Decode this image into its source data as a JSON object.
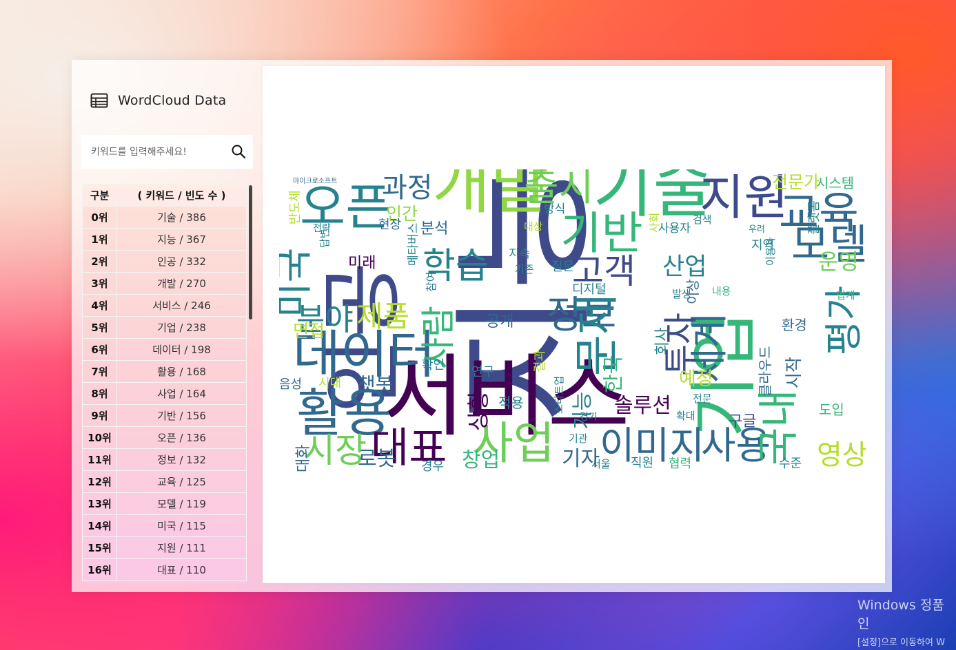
{
  "app": {
    "title": "WordCloud Data"
  },
  "search": {
    "placeholder": "키워드를 입력해주세요!"
  },
  "table": {
    "headers": [
      "구분",
      "( 키워드 / 빈도 수 )"
    ],
    "rows": [
      [
        "0위",
        "기술 / 386"
      ],
      [
        "1위",
        "지능 / 367"
      ],
      [
        "2위",
        "인공 / 332"
      ],
      [
        "3위",
        "개발 / 270"
      ],
      [
        "4위",
        "서비스 / 246"
      ],
      [
        "5위",
        "기업 / 238"
      ],
      [
        "6위",
        "데이터 / 198"
      ],
      [
        "7위",
        "활용 / 168"
      ],
      [
        "8위",
        "사업 / 164"
      ],
      [
        "9위",
        "기반 / 156"
      ],
      [
        "10위",
        "오픈 / 136"
      ],
      [
        "11위",
        "정보 / 132"
      ],
      [
        "12위",
        "교육 / 125"
      ],
      [
        "13위",
        "모델 / 119"
      ],
      [
        "14위",
        "미국 / 115"
      ],
      [
        "15위",
        "지원 / 111"
      ],
      [
        "16위",
        "대표 / 110"
      ]
    ]
  },
  "wordcloud": {
    "words": [
      {
        "t": "인공",
        "c": "#3e4a89"
      },
      {
        "t": "지능",
        "c": "#3e4a89"
      },
      {
        "t": "서비스",
        "c": "#440154"
      },
      {
        "t": "기업",
        "c": "#35b779"
      },
      {
        "t": "기술",
        "c": "#35b779"
      },
      {
        "t": "개발",
        "c": "#90d743"
      },
      {
        "t": "데이터",
        "c": "#31688e"
      },
      {
        "t": "활용",
        "c": "#31688e"
      },
      {
        "t": "사업",
        "c": "#6ece58"
      },
      {
        "t": "대표",
        "c": "#440154"
      },
      {
        "t": "오픈",
        "c": "#26828e"
      },
      {
        "t": "출시",
        "c": "#6ece58"
      },
      {
        "t": "지원",
        "c": "#3e4a89"
      },
      {
        "t": "교육",
        "c": "#31688e"
      },
      {
        "t": "정보",
        "c": "#31688e"
      },
      {
        "t": "모델",
        "c": "#31688e"
      },
      {
        "t": "기반",
        "c": "#35b779"
      },
      {
        "t": "학습",
        "c": "#26828e"
      },
      {
        "t": "이미지",
        "c": "#31688e"
      },
      {
        "t": "사용",
        "c": "#31688e"
      },
      {
        "t": "국내",
        "c": "#35b779"
      },
      {
        "t": "세계",
        "c": "#31688e"
      },
      {
        "t": "문제",
        "c": "#26828e"
      },
      {
        "t": "시장",
        "c": "#6ece58"
      },
      {
        "t": "분야",
        "c": "#26828e"
      },
      {
        "t": "미국",
        "c": "#26828e"
      },
      {
        "t": "고객",
        "c": "#3e4a89"
      },
      {
        "t": "제품",
        "c": "#b5de2b"
      },
      {
        "t": "사람",
        "c": "#35b779"
      },
      {
        "t": "과정",
        "c": "#31688e"
      },
      {
        "t": "영상",
        "c": "#b5de2b"
      },
      {
        "t": "평가",
        "c": "#26828e"
      },
      {
        "t": "산업",
        "c": "#26828e"
      },
      {
        "t": "투자",
        "c": "#3e4a89"
      },
      {
        "t": "솔루션",
        "c": "#440154"
      },
      {
        "t": "운영",
        "c": "#6ece58"
      },
      {
        "t": "예정",
        "c": "#b5de2b"
      },
      {
        "t": "기자",
        "c": "#31688e"
      },
      {
        "t": "창업",
        "c": "#35b779"
      },
      {
        "t": "로봇",
        "c": "#31688e"
      },
      {
        "t": "챗봇",
        "c": "#31688e"
      },
      {
        "t": "상황",
        "c": "#440154"
      },
      {
        "t": "한국",
        "c": "#35b779"
      },
      {
        "t": "기능",
        "c": "#26828e"
      },
      {
        "t": "공개",
        "c": "#31688e"
      },
      {
        "t": "미래",
        "c": "#440154"
      },
      {
        "t": "분석",
        "c": "#31688e"
      },
      {
        "t": "인간",
        "c": "#90d743"
      },
      {
        "t": "면접",
        "c": "#b5de2b"
      },
      {
        "t": "전문가",
        "c": "#b5de2b"
      },
      {
        "t": "시스템",
        "c": "#35b779"
      },
      {
        "t": "구글",
        "c": "#3e4a89"
      },
      {
        "t": "시작",
        "c": "#31688e"
      },
      {
        "t": "클라우드",
        "c": "#31688e"
      },
      {
        "t": "환경",
        "c": "#31688e"
      },
      {
        "t": "대화",
        "c": "#31688e"
      },
      {
        "t": "회사",
        "c": "#26828e"
      },
      {
        "t": "적용",
        "c": "#26828e"
      },
      {
        "t": "수준",
        "c": "#26828e"
      },
      {
        "t": "도입",
        "c": "#35b779"
      },
      {
        "t": "지역",
        "c": "#26828e"
      },
      {
        "t": "디지털",
        "c": "#26828e"
      },
      {
        "t": "질문",
        "c": "#26828e"
      },
      {
        "t": "이상",
        "c": "#31688e"
      },
      {
        "t": "현장",
        "c": "#31688e"
      },
      {
        "t": "확인",
        "c": "#26828e"
      },
      {
        "t": "연구",
        "c": "#26828e"
      },
      {
        "t": "시대",
        "c": "#b5de2b"
      },
      {
        "t": "음성",
        "c": "#31688e"
      },
      {
        "t": "경우",
        "c": "#26828e"
      },
      {
        "t": "직원",
        "c": "#26828e"
      },
      {
        "t": "협력",
        "c": "#35b779"
      },
      {
        "t": "서울",
        "c": "#26828e"
      },
      {
        "t": "기관",
        "c": "#26828e"
      },
      {
        "t": "경기",
        "c": "#26828e"
      },
      {
        "t": "확대",
        "c": "#26828e"
      },
      {
        "t": "전문",
        "c": "#26828e"
      },
      {
        "t": "방식",
        "c": "#26828e"
      },
      {
        "t": "대상",
        "c": "#b5de2b"
      },
      {
        "t": "지속",
        "c": "#26828e"
      },
      {
        "t": "기존",
        "c": "#26828e"
      },
      {
        "t": "전략",
        "c": "#26828e"
      },
      {
        "t": "결과",
        "c": "#b5de2b"
      },
      {
        "t": "사용자",
        "c": "#26828e"
      },
      {
        "t": "검색",
        "c": "#26828e"
      },
      {
        "t": "발생",
        "c": "#26828e"
      },
      {
        "t": "내용",
        "c": "#35b779"
      },
      {
        "t": "업계",
        "c": "#35b779"
      },
      {
        "t": "우려",
        "c": "#26828e"
      },
      {
        "t": "이용자",
        "c": "#26828e"
      },
      {
        "t": "플랫폼",
        "c": "#26828e"
      },
      {
        "t": "사회",
        "c": "#b5de2b"
      },
      {
        "t": "반도체",
        "c": "#b5de2b"
      },
      {
        "t": "답변",
        "c": "#26828e"
      },
      {
        "t": "메타버스",
        "c": "#26828e"
      },
      {
        "t": "참여",
        "c": "#26828e"
      },
      {
        "t": "스타트업",
        "c": "#26828e"
      },
      {
        "t": "마이크로소프트",
        "c": "#31688e"
      }
    ]
  },
  "watermark": {
    "line1": "Windows 정품 인",
    "line2": "[설정]으로 이동하여 W"
  }
}
